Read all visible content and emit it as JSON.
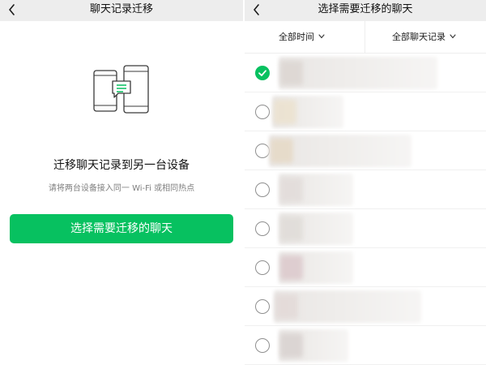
{
  "left_screen": {
    "nav_title": "聊天记录迁移",
    "migrate_title": "迁移聊天记录到另一台设备",
    "migrate_hint": "请将两台设备接入同一 Wi-Fi 或相同热点",
    "select_button_label": "选择需要迁移的聊天"
  },
  "right_screen": {
    "nav_title": "选择需要迁移的聊天",
    "filters": {
      "time_label": "全部时间",
      "records_label": "全部聊天记录"
    },
    "chats": [
      {
        "selected": true
      },
      {
        "selected": false
      },
      {
        "selected": false
      },
      {
        "selected": false
      },
      {
        "selected": false
      },
      {
        "selected": false
      },
      {
        "selected": false
      },
      {
        "selected": false
      }
    ]
  },
  "colors": {
    "accent": "#07c160",
    "navbar_bg": "#ededed",
    "hint_text": "#808080"
  },
  "icons": {
    "back": "chevron-left-icon",
    "filter_dropdown": "chevron-down-icon",
    "check": "check-icon",
    "illustration": "two-phones-transfer-icon"
  }
}
